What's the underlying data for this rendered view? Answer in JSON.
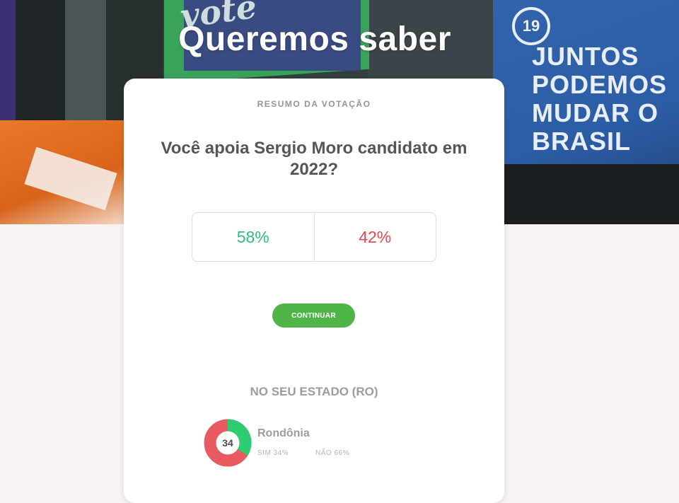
{
  "page": {
    "heading": "Queremos saber"
  },
  "background": {
    "banner_number": "19",
    "banner_lines": [
      "JUNTOS",
      "PODEMOS",
      "MUDAR O",
      "BRASIL"
    ],
    "vote_text": "vote"
  },
  "card": {
    "eyebrow": "RESUMO DA VOTAÇÃO",
    "question": "Você apoia Sergio Moro candidato em 2022?",
    "results": {
      "yes_percent": "58%",
      "no_percent": "42%"
    },
    "continue_label": "CONTINUAR",
    "state_section": {
      "heading": "NO SEU ESTADO (RO)",
      "state_name": "Rondônia",
      "donut_value": "34",
      "yes_fraction": 0.34,
      "yes_label": "SIM 34%",
      "no_label": "NÃO 66%"
    }
  },
  "colors": {
    "yes": "#2ebc85",
    "no": "#e5484d",
    "donut_yes": "#2ecc71",
    "donut_no": "#e85a5f",
    "button": "#4fb546"
  }
}
